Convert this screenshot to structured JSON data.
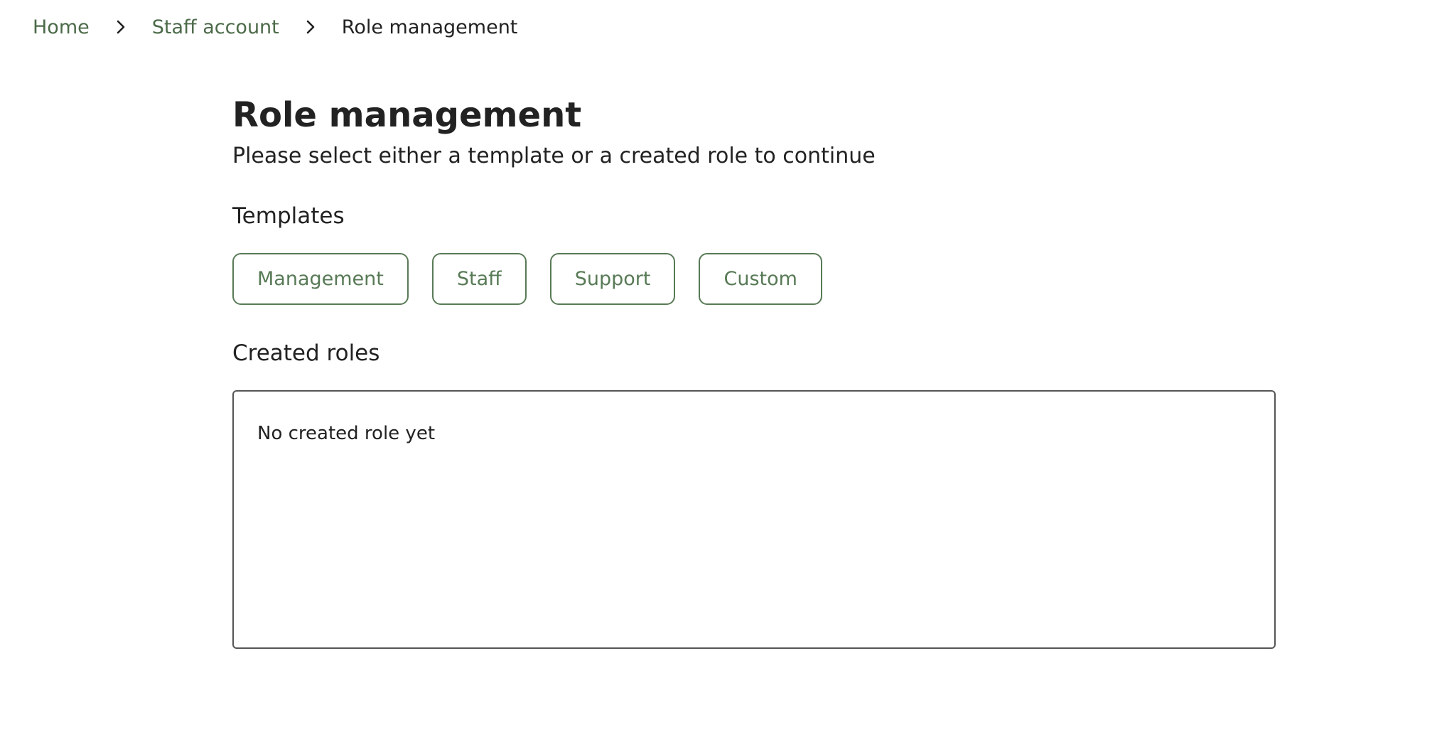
{
  "breadcrumb": {
    "items": [
      {
        "label": "Home"
      },
      {
        "label": "Staff account"
      },
      {
        "label": "Role management"
      }
    ],
    "separator_icon": "chevron-right-icon"
  },
  "header": {
    "title": "Role management",
    "subtitle": "Please select either a template or a created role to continue"
  },
  "templates": {
    "heading": "Templates",
    "buttons": [
      {
        "label": "Management"
      },
      {
        "label": "Staff"
      },
      {
        "label": "Support"
      },
      {
        "label": "Custom"
      }
    ]
  },
  "created_roles": {
    "heading": "Created roles",
    "empty_text": "No created role yet"
  },
  "colors": {
    "accent": "#587a56",
    "link": "#4c6a49",
    "text": "#222222",
    "border": "#555555"
  }
}
